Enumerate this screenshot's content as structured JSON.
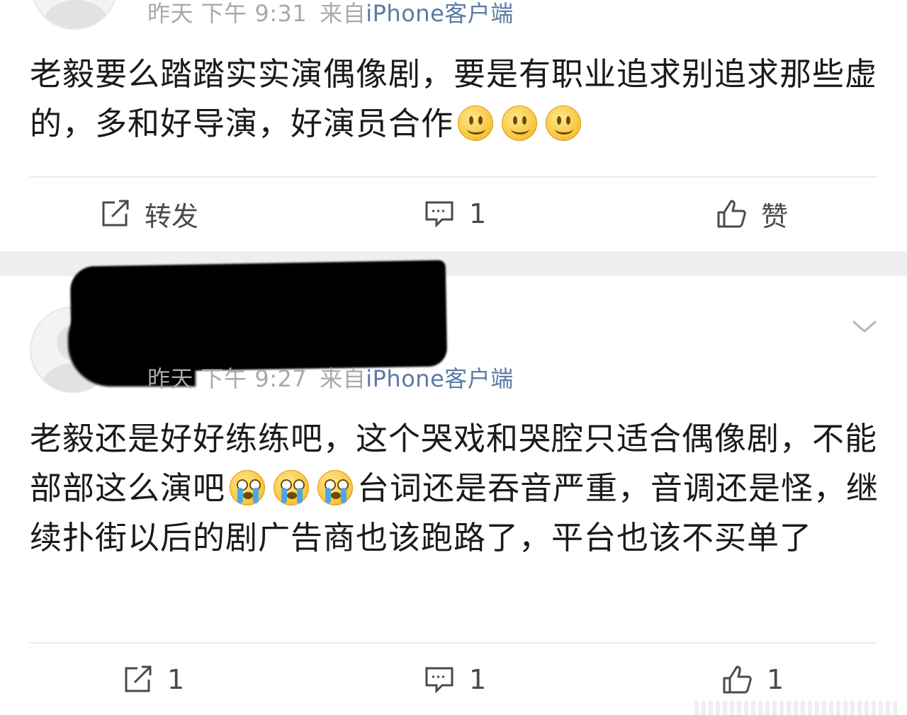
{
  "posts": [
    {
      "meta": {
        "time": "昨天 下午 9:31",
        "source_prefix": "来自",
        "source_link": "iPhone客户端"
      },
      "content": "老毅要么踏踏实实演偶像剧，要是有职业追求别追求那些虚的，多和好导演，好演员合作",
      "emojis": [
        "smile-emoji",
        "smile-emoji",
        "smile-emoji"
      ],
      "actions": {
        "repost": "转发",
        "comment": "1",
        "like": "赞"
      }
    },
    {
      "meta": {
        "time": "昨天 下午 9:27",
        "source_prefix": "来自",
        "source_link": "iPhone客户端"
      },
      "content_part1": "老毅还是好好练练吧，这个哭戏和哭腔只适合偶像剧，不能部部这么演吧",
      "emojis": [
        "crying-emoji",
        "crying-emoji",
        "crying-emoji"
      ],
      "content_part2": "台词还是吞音严重，音调还是怪，继续扑街以后的剧广告商也该跑路了，平台也该不买单了",
      "actions": {
        "repost": "1",
        "comment": "1",
        "like": "1"
      }
    }
  ],
  "colors": {
    "meta_text": "#a9a9a9",
    "source_link": "#5b7aa6",
    "separator": "#efefef",
    "action_icon": "#4a4a4a"
  }
}
